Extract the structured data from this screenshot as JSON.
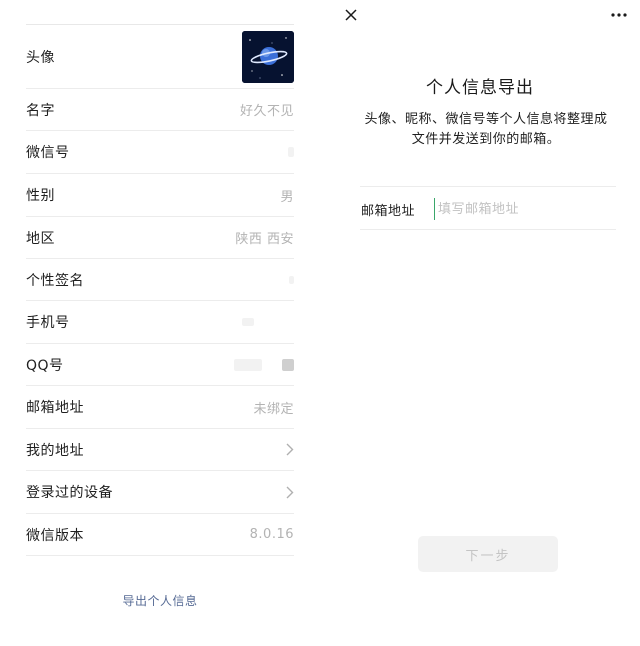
{
  "profile": {
    "rows": [
      {
        "label": "头像",
        "value": ""
      },
      {
        "label": "名字",
        "value": "好久不见"
      },
      {
        "label": "微信号",
        "value": ""
      },
      {
        "label": "性别",
        "value": "男"
      },
      {
        "label": "地区",
        "value": "陕西 西安"
      },
      {
        "label": "个性签名",
        "value": ""
      },
      {
        "label": "手机号",
        "value": ""
      },
      {
        "label": "QQ号",
        "value": ""
      },
      {
        "label": "邮箱地址",
        "value": "未绑定"
      },
      {
        "label": "我的地址",
        "value": ""
      },
      {
        "label": "登录过的设备",
        "value": ""
      },
      {
        "label": "微信版本",
        "value": "8.0.16"
      }
    ],
    "export_link": "导出个人信息"
  },
  "export_page": {
    "title": "个人信息导出",
    "description": "头像、昵称、微信号等个人信息将整理成文件并发送到你的邮箱。",
    "email_label": "邮箱地址",
    "email_value": "",
    "email_placeholder": "填写邮箱地址",
    "next_label": "下一步"
  },
  "colors": {
    "link": "#576b95",
    "cursor": "#3aa66a",
    "button_disabled_bg": "#f2f2f2"
  },
  "icons": {
    "close": "close-icon",
    "more": "more-icon",
    "chevron": "chevron-right-icon"
  }
}
